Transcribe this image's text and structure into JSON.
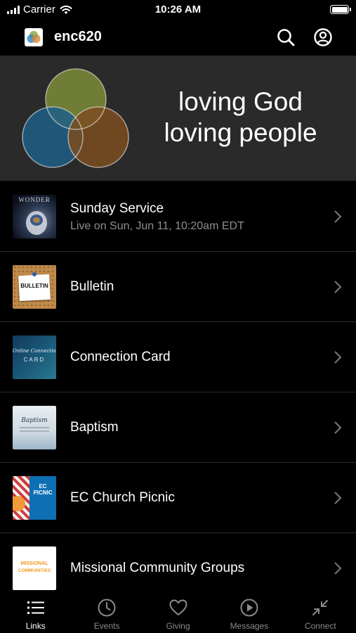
{
  "status_bar": {
    "carrier": "Carrier",
    "time": "10:26 AM"
  },
  "header": {
    "title": "enc620",
    "icons": [
      "search-icon",
      "profile-icon"
    ]
  },
  "banner": {
    "line1": "loving God",
    "line2": "loving people",
    "circle_colors": [
      "#7c8c3a",
      "#1e5f86",
      "#7b4c1e"
    ]
  },
  "links": [
    {
      "title": "Sunday Service",
      "subtitle": "Live on Sun, Jun 11, 10:20am EDT",
      "thumb_text": "WONDER"
    },
    {
      "title": "Bulletin",
      "subtitle": "",
      "thumb_text": "BULLETIN"
    },
    {
      "title": "Connection Card",
      "subtitle": "",
      "thumb_text": "Online Connection",
      "thumb_text2": "CARD"
    },
    {
      "title": "Baptism",
      "subtitle": "",
      "thumb_text": "Baptism"
    },
    {
      "title": "EC Church Picnic",
      "subtitle": "",
      "thumb_text": "EC PICNIC"
    },
    {
      "title": "Missional Community Groups",
      "subtitle": "",
      "thumb_text": "MISSIONAL",
      "thumb_text2": "COMMUNITIES"
    }
  ],
  "tabs": [
    {
      "label": "Links",
      "icon": "list-icon",
      "active": true
    },
    {
      "label": "Events",
      "icon": "clock-icon",
      "active": false
    },
    {
      "label": "Giving",
      "icon": "heart-icon",
      "active": false
    },
    {
      "label": "Messages",
      "icon": "play-circle-icon",
      "active": false
    },
    {
      "label": "Connect",
      "icon": "collapse-arrows-icon",
      "active": false
    }
  ],
  "colors": {
    "background": "#000000",
    "banner_bg": "#2a2a2a",
    "subtitle": "#8e8e93",
    "inactive_tab": "#8a8a8a"
  }
}
